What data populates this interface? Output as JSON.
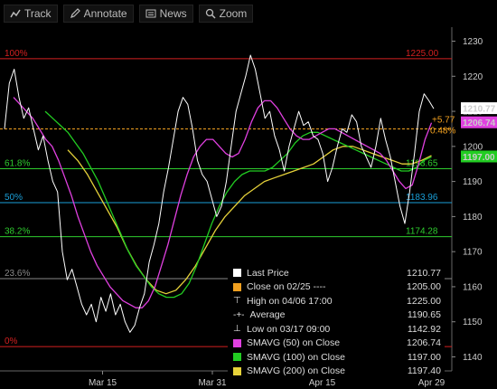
{
  "toolbar": {
    "items": [
      {
        "label": "Track",
        "icon": "track-icon"
      },
      {
        "label": "Annotate",
        "icon": "annotate-icon"
      },
      {
        "label": "News",
        "icon": "news-icon"
      },
      {
        "label": "Zoom",
        "icon": "zoom-icon"
      }
    ]
  },
  "chart_data": {
    "type": "line",
    "ylim": [
      1136,
      1234
    ],
    "y_ticks": [
      1140,
      1150,
      1160,
      1170,
      1180,
      1190,
      1200,
      1210,
      1220,
      1230
    ],
    "x_ticks": [
      "Mar 15",
      "Mar 31",
      "Apr 15",
      "Apr 29"
    ],
    "x_tick_pos": [
      0.227,
      0.47,
      0.713,
      0.955
    ],
    "series": [
      {
        "name": "Last Price",
        "color": "#ffffff",
        "values": [
          1205,
          1218,
          1222,
          1214,
          1208,
          1211,
          1205,
          1199,
          1203,
          1196,
          1190,
          1187,
          1170,
          1162,
          1165,
          1160,
          1155,
          1152,
          1155,
          1150,
          1157,
          1153,
          1158,
          1152,
          1155,
          1150,
          1147,
          1149,
          1154,
          1158,
          1167,
          1172,
          1178,
          1187,
          1194,
          1202,
          1210,
          1214,
          1212,
          1205,
          1196,
          1192,
          1190,
          1185,
          1180,
          1183,
          1190,
          1200,
          1210,
          1215,
          1220,
          1226,
          1222,
          1215,
          1208,
          1210,
          1203,
          1199,
          1193,
          1200,
          1205,
          1210,
          1206,
          1207,
          1203,
          1202,
          1198,
          1190,
          1194,
          1200,
          1205,
          1204,
          1209,
          1207,
          1200,
          1197,
          1194,
          1200,
          1208,
          1202,
          1197,
          1190,
          1183,
          1178,
          1187,
          1198,
          1210,
          1215,
          1213,
          1210.77
        ]
      },
      {
        "name": "SMAVG (50) on Close",
        "color": "#e040e0",
        "values": [
          1214,
          1212,
          1210,
          1208,
          1205,
          1202,
          1200,
          1196,
          1191,
          1186,
          1180,
          1175,
          1170,
          1166,
          1163,
          1160,
          1158,
          1156,
          1155,
          1154,
          1154,
          1156,
          1160,
          1166,
          1172,
          1179,
          1186,
          1192,
          1197,
          1200,
          1202,
          1202,
          1200,
          1198,
          1197,
          1198,
          1202,
          1207,
          1211,
          1213,
          1213,
          1211,
          1208,
          1205,
          1203,
          1202,
          1202,
          1203,
          1204,
          1205,
          1205,
          1204,
          1203,
          1202,
          1201,
          1200,
          1199,
          1198,
          1196,
          1193,
          1190,
          1188,
          1189,
          1195,
          1202,
          1206.74
        ]
      },
      {
        "name": "SMAVG (100) on Close",
        "color": "#22cc22",
        "values": [
          1210,
          1208,
          1206,
          1204,
          1201,
          1198,
          1194,
          1190,
          1185,
          1180,
          1175,
          1170,
          1166,
          1163,
          1160,
          1158,
          1157,
          1157,
          1158,
          1161,
          1166,
          1172,
          1178,
          1183,
          1187,
          1190,
          1192,
          1193,
          1193,
          1193,
          1194,
          1196,
          1198,
          1201,
          1203,
          1204,
          1204,
          1203,
          1202,
          1201,
          1200,
          1199,
          1198,
          1197,
          1196,
          1195,
          1194,
          1193,
          1193,
          1194,
          1196,
          1197
        ]
      },
      {
        "name": "SMAVG (200) on Close",
        "color": "#e6d23a",
        "values": [
          1199,
          1196,
          1192,
          1187,
          1182,
          1177,
          1171,
          1166,
          1162,
          1159,
          1158,
          1159,
          1162,
          1166,
          1171,
          1176,
          1180,
          1183,
          1186,
          1188,
          1190,
          1191,
          1192,
          1193,
          1194,
          1195,
          1197,
          1199,
          1200,
          1200,
          1199,
          1198,
          1197,
          1196,
          1195,
          1195,
          1196,
          1197.4
        ]
      }
    ],
    "series_ranges": [
      [
        0.01,
        0.96
      ],
      [
        0.03,
        0.955
      ],
      [
        0.1,
        0.955
      ],
      [
        0.15,
        0.955
      ]
    ],
    "fib_levels": [
      {
        "label": "100%",
        "value": 1225.0,
        "value_text": "1225.00",
        "color": "#d42020"
      },
      {
        "label": "61.8%",
        "value": 1193.65,
        "value_text": "1193.65",
        "color": "#2ecc2e"
      },
      {
        "label": "50%",
        "value": 1183.96,
        "value_text": "1183.96",
        "color": "#1a9fd8"
      },
      {
        "label": "38.2%",
        "value": 1174.28,
        "value_text": "1174.28",
        "color": "#2ecc2e"
      },
      {
        "label": "23.6%",
        "value": 1162.29,
        "value_text": "1162.29",
        "color": "#888888"
      },
      {
        "label": "0%",
        "value": 1142.92,
        "value_text": "1142.92",
        "color": "#d42020"
      }
    ],
    "close_line": {
      "value": 1205.0,
      "color": "#f0a020"
    },
    "change_labels": {
      "abs": "+5.77",
      "pct": "0.48%",
      "color": "#f0a020"
    },
    "price_tags": [
      {
        "text": "1210.77",
        "value": 1210.77,
        "bg": "#ffffff",
        "fg": "#000000"
      },
      {
        "text": "1206.74",
        "value": 1206.74,
        "bg": "#e040e0",
        "fg": "#000000"
      },
      {
        "text": "1197.00",
        "value": 1197.0,
        "bg": "#22cc22",
        "fg": "#000000"
      }
    ],
    "legend": [
      {
        "label": "Last Price",
        "value": "1210.77",
        "swatch": "#ffffff"
      },
      {
        "label": "Close on 02/25 ----",
        "value": "1205.00",
        "swatch": "#f0a020"
      },
      {
        "label": "High on 04/06 17:00",
        "value": "1225.00",
        "swatch": "",
        "symbol": "⊤"
      },
      {
        "label": "Average",
        "value": "1190.65",
        "swatch": "",
        "symbol": "-+-"
      },
      {
        "label": "Low on 03/17 09:00",
        "value": "1142.92",
        "swatch": "",
        "symbol": "⊥"
      },
      {
        "label": "SMAVG (50) on Close",
        "value": "1206.74",
        "swatch": "#e040e0"
      },
      {
        "label": "SMAVG (100) on Close",
        "value": "1197.00",
        "swatch": "#22cc22"
      },
      {
        "label": "SMAVG (200) on Close",
        "value": "1197.40",
        "swatch": "#e6d23a"
      }
    ]
  }
}
